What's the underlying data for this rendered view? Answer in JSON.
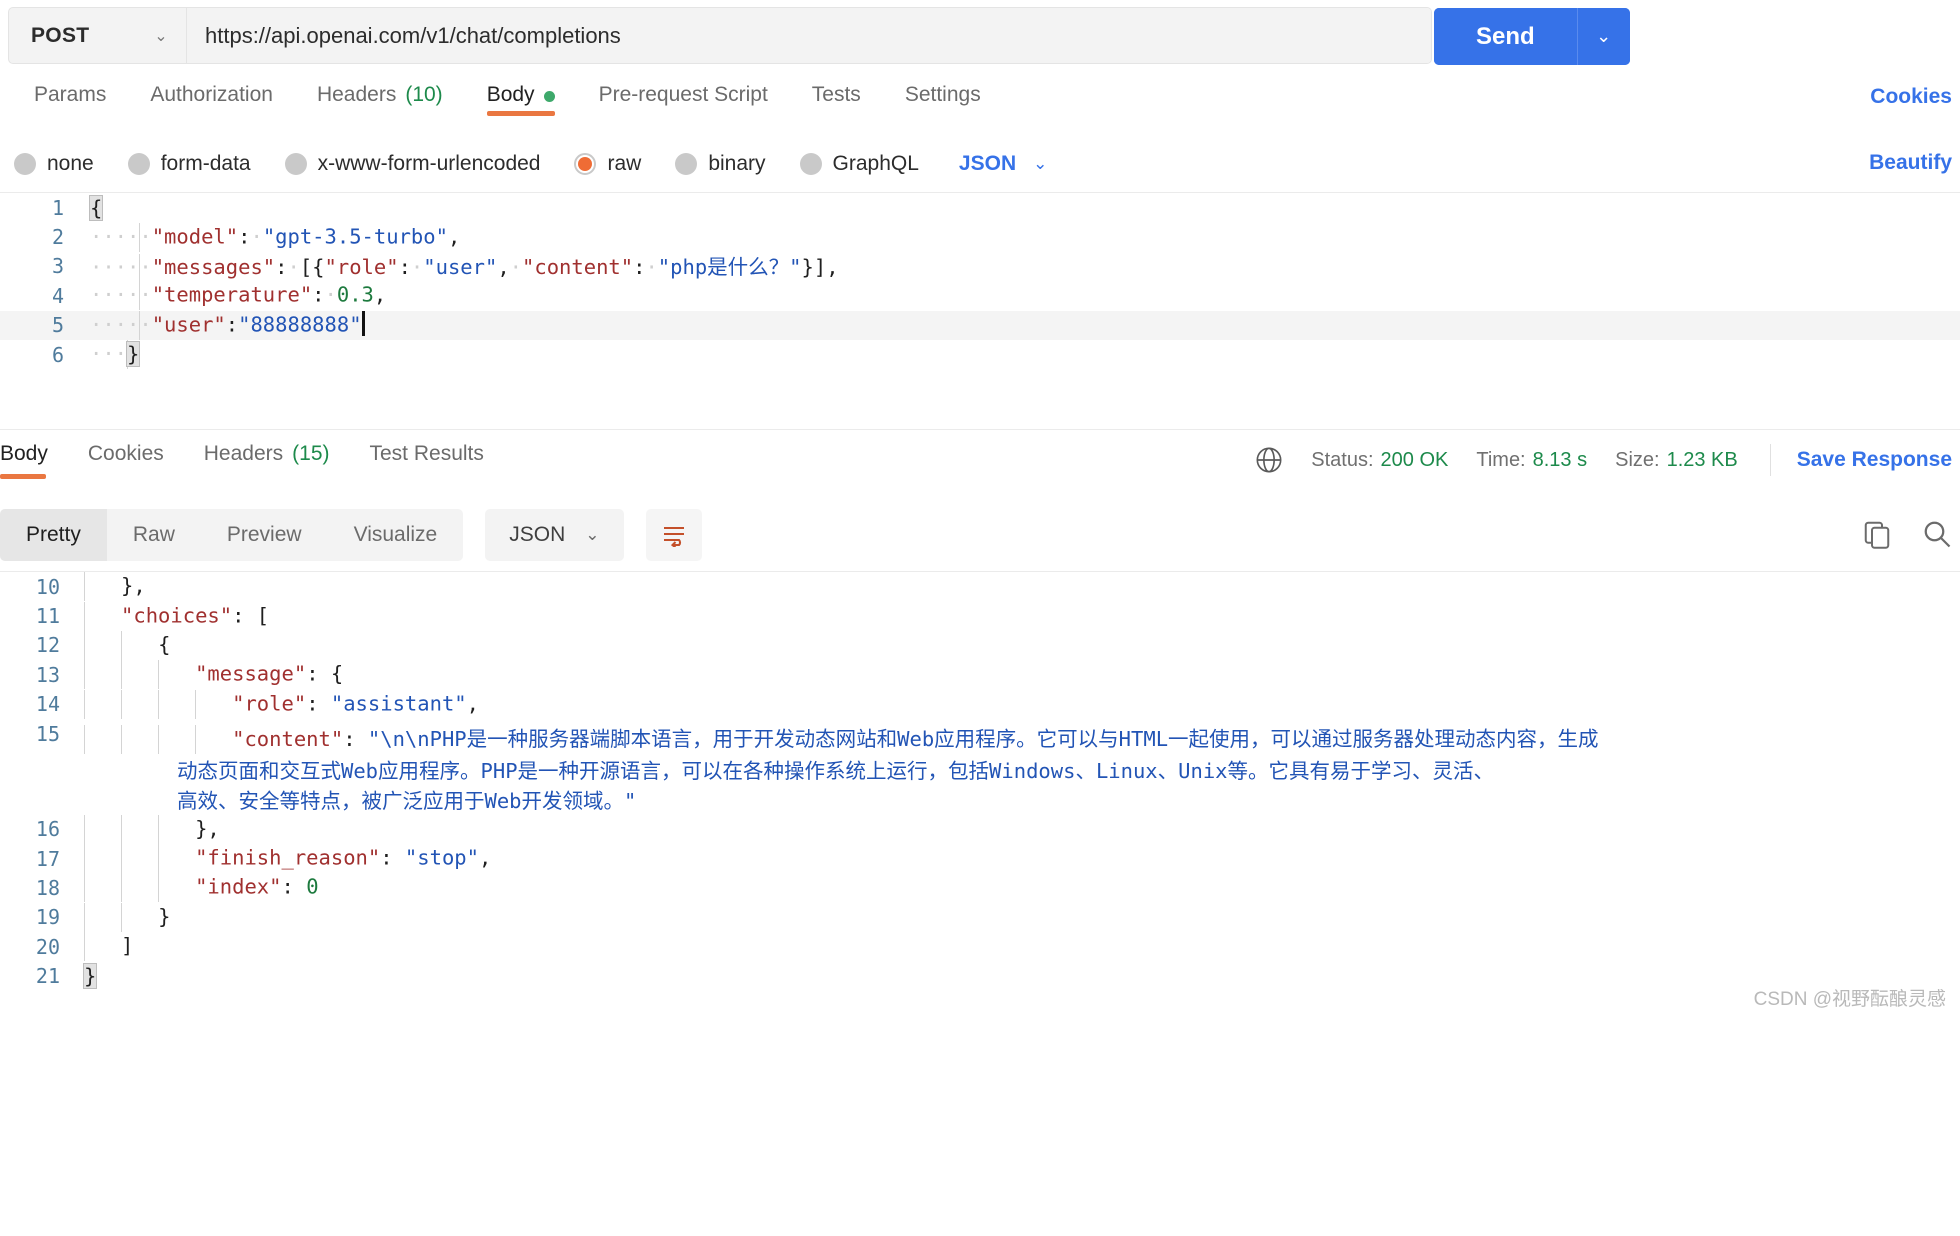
{
  "request": {
    "method": "POST",
    "method_chevron": "chevron-down",
    "url": "https://api.openai.com/v1/chat/completions",
    "send_label": "Send",
    "send_caret": "⌄",
    "tabs": [
      {
        "label": "Params",
        "count": "",
        "active": false,
        "dot": false
      },
      {
        "label": "Authorization",
        "count": "",
        "active": false,
        "dot": false
      },
      {
        "label": "Headers",
        "count": "(10)",
        "active": false,
        "dot": false
      },
      {
        "label": "Body",
        "count": "",
        "active": true,
        "dot": true
      },
      {
        "label": "Pre-request Script",
        "count": "",
        "active": false,
        "dot": false
      },
      {
        "label": "Tests",
        "count": "",
        "active": false,
        "dot": false
      },
      {
        "label": "Settings",
        "count": "",
        "active": false,
        "dot": false
      }
    ],
    "cookies_link": "Cookies",
    "body_types": [
      {
        "label": "none",
        "selected": false
      },
      {
        "label": "form-data",
        "selected": false
      },
      {
        "label": "x-www-form-urlencoded",
        "selected": false
      },
      {
        "label": "raw",
        "selected": true
      },
      {
        "label": "binary",
        "selected": false
      },
      {
        "label": "GraphQL",
        "selected": false
      }
    ],
    "raw_format": "JSON",
    "beautify_link": "Beautify",
    "body_lines": [
      {
        "n": "1",
        "text": "{"
      },
      {
        "n": "2",
        "text": "    \"model\": \"gpt-3.5-turbo\","
      },
      {
        "n": "3",
        "text": "    \"messages\": [{\"role\": \"user\", \"content\": \"php是什么？\"}],"
      },
      {
        "n": "4",
        "text": "    \"temperature\": 0.3,"
      },
      {
        "n": "5",
        "text": "    \"user\":\"88888888\"",
        "active": true
      },
      {
        "n": "6",
        "text": "}"
      }
    ],
    "body_json": {
      "model": "gpt-3.5-turbo",
      "messages_role": "user",
      "messages_content": "php是什么？",
      "temperature": "0.3",
      "user": "88888888"
    }
  },
  "response": {
    "tabs": [
      {
        "label": "Body",
        "count": "",
        "active": true
      },
      {
        "label": "Cookies",
        "count": "",
        "active": false
      },
      {
        "label": "Headers",
        "count": "(15)",
        "active": false
      },
      {
        "label": "Test Results",
        "count": "",
        "active": false
      }
    ],
    "status_label": "Status:",
    "status_value": "200 OK",
    "time_label": "Time:",
    "time_value": "8.13 s",
    "size_label": "Size:",
    "size_value": "1.23 KB",
    "save_response": "Save Response",
    "view_modes": [
      {
        "label": "Pretty",
        "active": true
      },
      {
        "label": "Raw",
        "active": false
      },
      {
        "label": "Preview",
        "active": false
      },
      {
        "label": "Visualize",
        "active": false
      }
    ],
    "format": "JSON",
    "lines": [
      {
        "n": "10",
        "text": "    },"
      },
      {
        "n": "11",
        "text": "    \"choices\": ["
      },
      {
        "n": "12",
        "text": "        {"
      },
      {
        "n": "13",
        "text": "            \"message\": {"
      },
      {
        "n": "14",
        "text": "                \"role\": \"assistant\","
      },
      {
        "n": "15",
        "text": "                \"content\": \"\\n\\nPHP是一种服务器端脚本语言，用于开发动态网站和Web应用程序。它可以与HTML一起使用，可以通过服务器处理动态内容，生成动态页面和交互式Web应用程序。PHP是一种开源语言，可以在各种操作系统上运行，包括Windows、Linux、Unix等。它具有易于学习、灵活、高效、安全等特点，被广泛应用于Web开发领域。\""
      },
      {
        "n": "16",
        "text": "            },"
      },
      {
        "n": "17",
        "text": "            \"finish_reason\": \"stop\","
      },
      {
        "n": "18",
        "text": "            \"index\": 0"
      },
      {
        "n": "19",
        "text": "        }"
      },
      {
        "n": "20",
        "text": "    ]"
      },
      {
        "n": "21",
        "text": "}"
      }
    ],
    "content_segments": {
      "line1": "\"content\": \"\\n\\nPHP是一种服务器端脚本语言，用于开发动态网站和Web应用程序。它可以与HTML一起使用，可以通过服务器处理动态内容，生成",
      "line2": "动态页面和交互式Web应用程序。PHP是一种开源语言，可以在各种操作系统上运行，包括Windows、Linux、Unix等。它具有易于学习、灵活、",
      "line3": "高效、安全等特点，被广泛应用于Web开发领域。\""
    }
  },
  "watermark": "CSDN @视野酝酿灵感",
  "colors": {
    "accent_orange": "#ea7741",
    "brand_blue": "#3672e8",
    "status_green": "#1d8a4b",
    "json_key": "#a0302f",
    "json_string": "#2254b5",
    "json_number": "#1d7a3e"
  }
}
